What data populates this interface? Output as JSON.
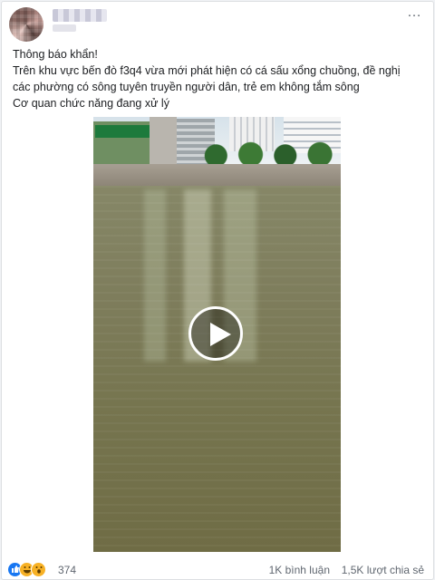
{
  "post": {
    "more_icon": "…",
    "lines": [
      "Thông báo khẩn!",
      "Trên khu vực bến đò f3q4 vừa mới phát hiện có cá sấu xổng chuồng, đề nghị",
      "các phường có sông tuyên truyền người dân, trẻ em không tắm sông",
      "Cơ quan chức năng đang xử lý"
    ]
  },
  "video": {
    "play_icon": "play-icon",
    "sign_text": "FAMIMAP"
  },
  "footer": {
    "reactions": [
      "like-icon",
      "haha-icon",
      "wow-icon"
    ],
    "reaction_count": "374",
    "comments": "1K bình luận",
    "shares": "1,5K lượt chia sẻ"
  },
  "colors": {
    "like": "#1877f2",
    "emoji": "#f7b125",
    "muted_text": "#606770"
  }
}
